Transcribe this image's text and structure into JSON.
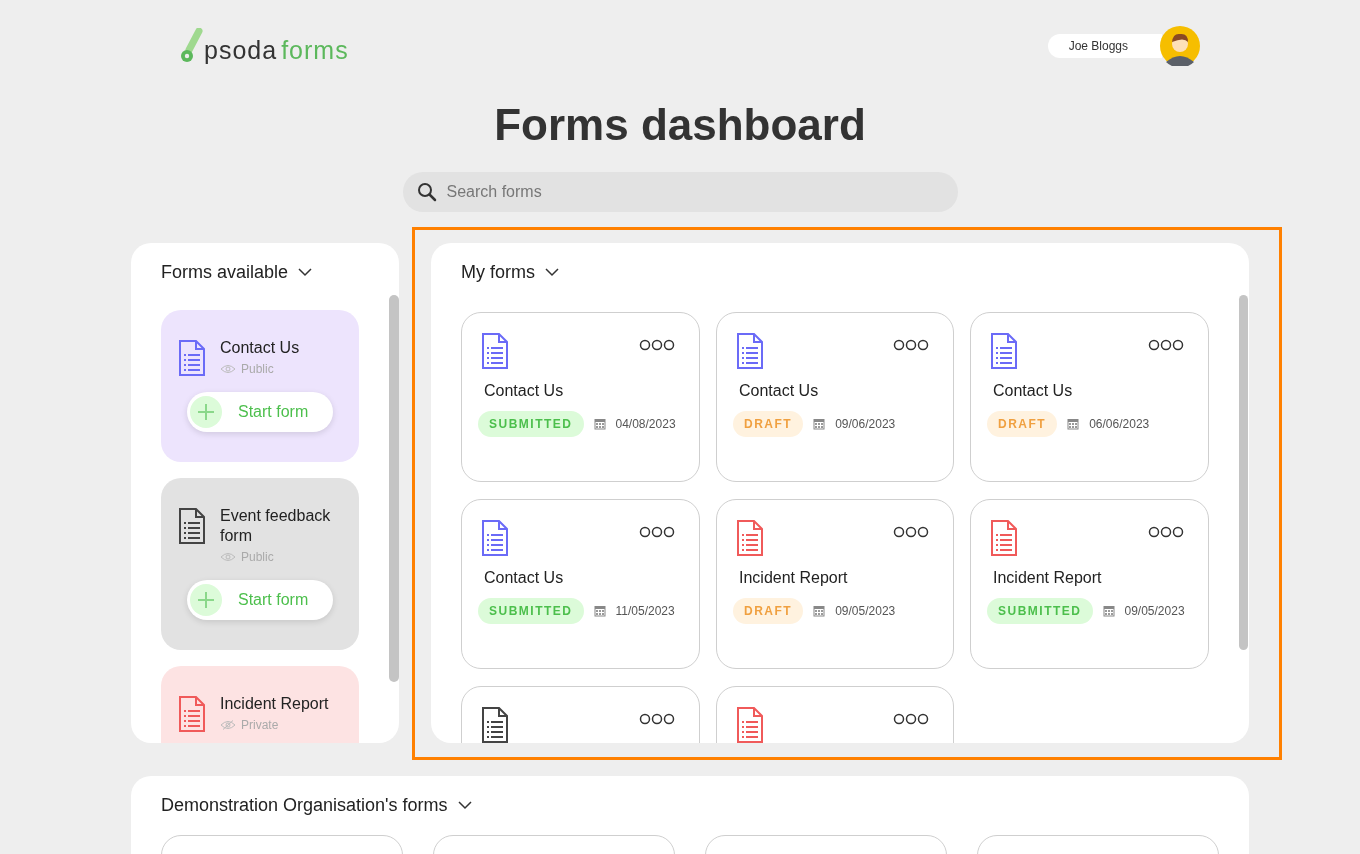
{
  "header": {
    "logo": {
      "word": "psoda",
      "suffix": "forms"
    },
    "user": {
      "name": "Joe Bloggs"
    }
  },
  "title": "Forms dashboard",
  "search": {
    "placeholder": "Search forms"
  },
  "forms_available": {
    "heading": "Forms available",
    "items": [
      {
        "name": "Contact Us",
        "color": "#6b6bf7",
        "visibility": "Public",
        "private": false,
        "start_button": "Start form"
      },
      {
        "name": "Event feedback form",
        "color": "#444444",
        "visibility": "Public",
        "private": false,
        "start_button": "Start form"
      },
      {
        "name": "Incident Report",
        "color": "#f05a5a",
        "visibility": "Private",
        "private": true
      }
    ]
  },
  "my_forms": {
    "heading": "My forms",
    "items": [
      {
        "name": "Contact Us",
        "color": "#6b6bf7",
        "kind": "submitted",
        "badge": "SUBMITTED",
        "date": "04/08/2023"
      },
      {
        "name": "Contact Us",
        "color": "#6b6bf7",
        "kind": "draft",
        "badge": "DRAFT",
        "date": "09/06/2023"
      },
      {
        "name": "Contact Us",
        "color": "#6b6bf7",
        "kind": "draft",
        "badge": "DRAFT",
        "date": "06/06/2023"
      },
      {
        "name": "Contact Us",
        "color": "#6b6bf7",
        "kind": "submitted",
        "badge": "SUBMITTED",
        "date": "11/05/2023"
      },
      {
        "name": "Incident Report",
        "color": "#f05a5a",
        "kind": "draft",
        "badge": "DRAFT",
        "date": "09/05/2023"
      },
      {
        "name": "Incident Report",
        "color": "#f05a5a",
        "kind": "submitted",
        "badge": "SUBMITTED",
        "date": "09/05/2023"
      },
      {
        "color": "#444444"
      },
      {
        "color": "#f05a5a"
      }
    ]
  },
  "organisation_forms": {
    "heading": "Demonstration Organisation's forms"
  }
}
